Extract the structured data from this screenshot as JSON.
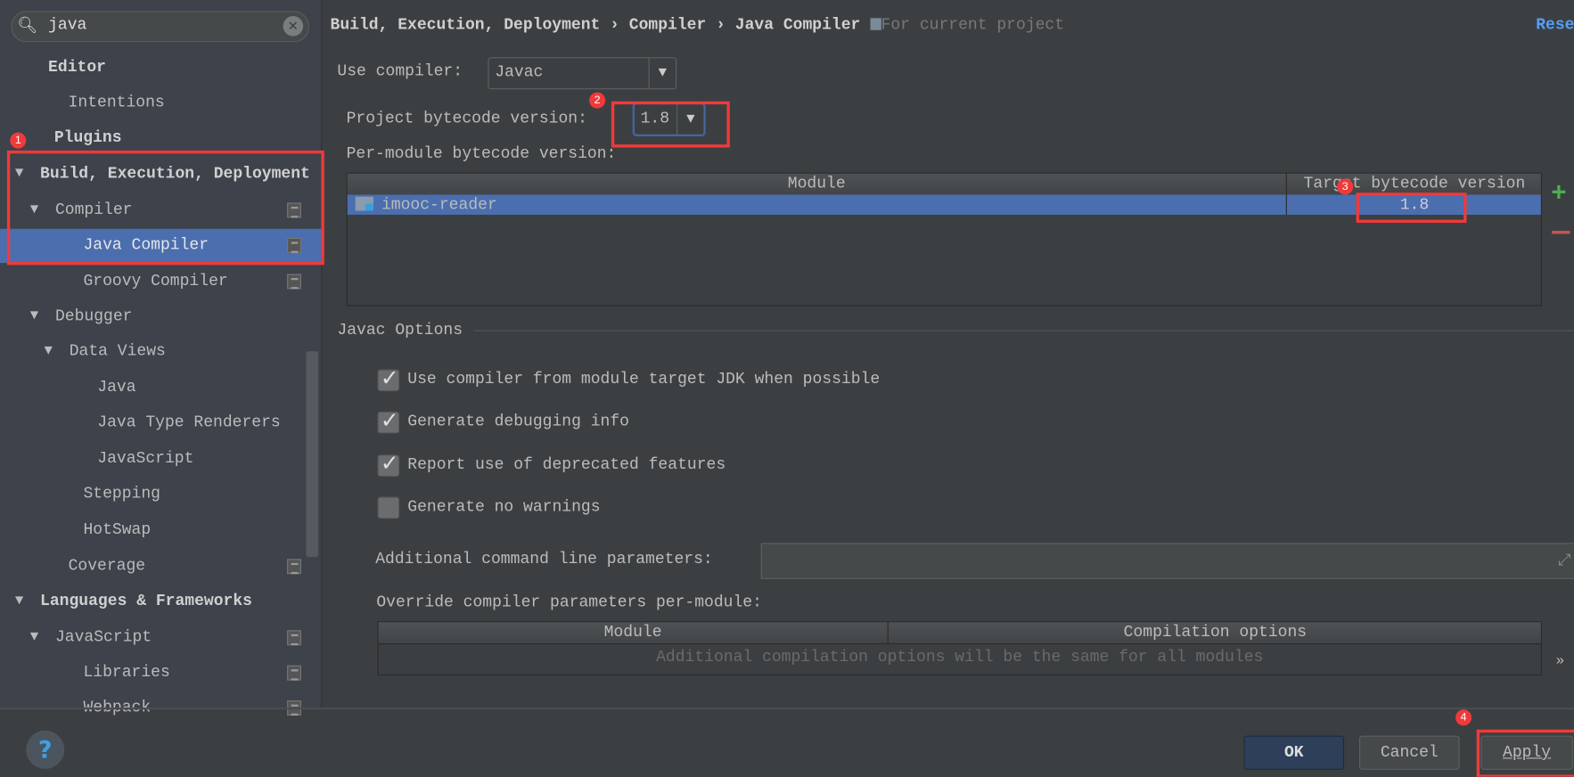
{
  "search": {
    "value": "java",
    "icon": "search-icon",
    "clear_icon": "clear-icon"
  },
  "sidebar": {
    "items": [
      {
        "label": "Editor"
      },
      {
        "label": "Intentions"
      },
      {
        "label": "Plugins"
      },
      {
        "label": "Build, Execution, Deployment"
      },
      {
        "label": "Compiler"
      },
      {
        "label": "Java Compiler"
      },
      {
        "label": "Groovy Compiler"
      },
      {
        "label": "Debugger"
      },
      {
        "label": "Data Views"
      },
      {
        "label": "Java"
      },
      {
        "label": "Java Type Renderers"
      },
      {
        "label": "JavaScript"
      },
      {
        "label": "Stepping"
      },
      {
        "label": "HotSwap"
      },
      {
        "label": "Coverage"
      },
      {
        "label": "Languages & Frameworks"
      },
      {
        "label": "JavaScript"
      },
      {
        "label": "Libraries"
      },
      {
        "label": "Webpack"
      }
    ],
    "selected": "Java Compiler"
  },
  "breadcrumb": {
    "items": [
      "Build, Execution, Deployment",
      "Compiler",
      "Java Compiler"
    ],
    "scope": "For current project",
    "reset": "Reset"
  },
  "compiler": {
    "label": "Use compiler:",
    "value": "Javac"
  },
  "bytecode": {
    "label": "Project bytecode version:",
    "value": "1.8"
  },
  "per_module": {
    "label": "Per-module bytecode version:",
    "columns": [
      "Module",
      "Target bytecode version"
    ],
    "rows": [
      {
        "module": "imooc-reader",
        "version": "1.8"
      }
    ]
  },
  "javac": {
    "title": "Javac Options",
    "options": [
      {
        "label": "Use compiler from module target JDK when possible",
        "checked": true
      },
      {
        "label": "Generate debugging info",
        "checked": true
      },
      {
        "label": "Report use of deprecated features",
        "checked": true
      },
      {
        "label": "Generate no warnings",
        "checked": false
      }
    ],
    "cmd_label": "Additional command line parameters:",
    "cmd_value": "",
    "override_label": "Override compiler parameters per-module:",
    "override_columns": [
      "Module",
      "Compilation options"
    ],
    "override_empty": "Additional compilation options will be the same for all modules",
    "more": "»"
  },
  "buttons": {
    "ok": "OK",
    "cancel": "Cancel",
    "apply": "Apply",
    "help": "?"
  },
  "annotations": [
    "1",
    "2",
    "3",
    "4"
  ],
  "colors": {
    "selection": "#4b6eaf",
    "annotation": "#f03a3a",
    "link": "#589df6"
  }
}
